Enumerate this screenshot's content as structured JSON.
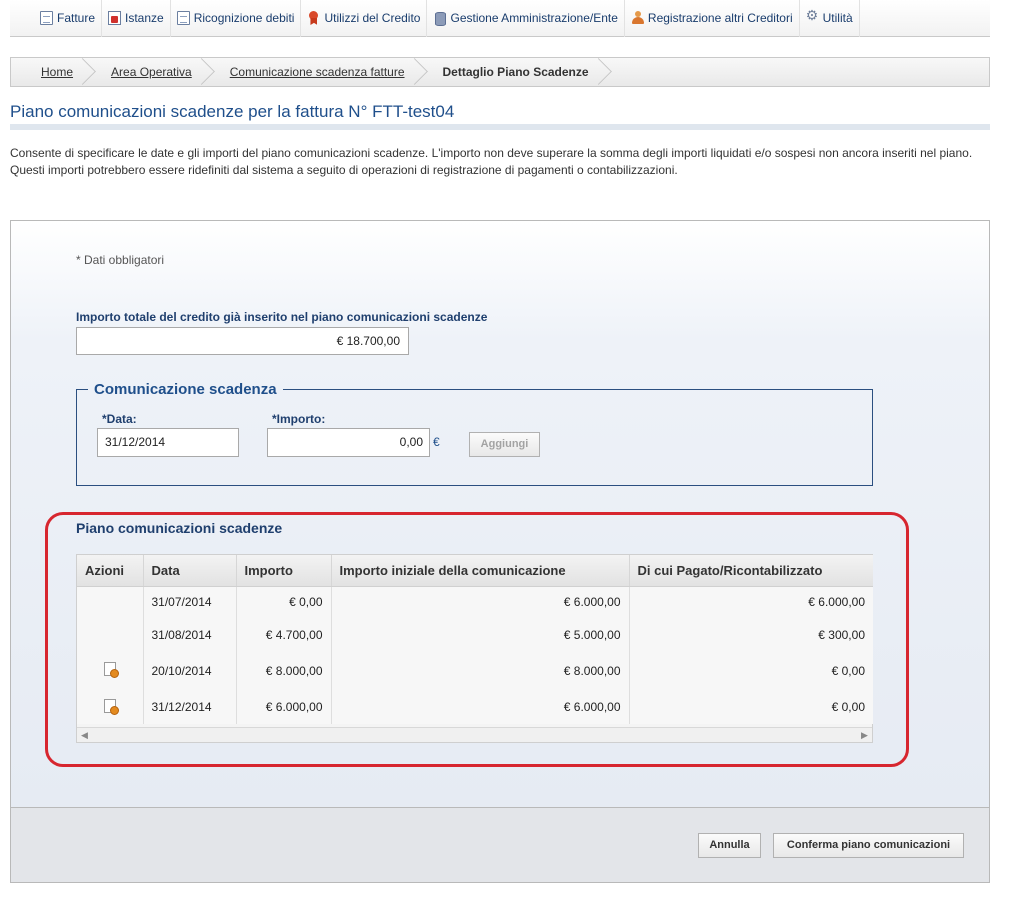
{
  "nav": {
    "items": [
      {
        "label": "Fatture",
        "icon": "document-icon"
      },
      {
        "label": "Istanze",
        "icon": "red-document-icon"
      },
      {
        "label": "Ricognizione debiti",
        "icon": "document-icon"
      },
      {
        "label": "Utilizzi del Credito",
        "icon": "ribbon-icon"
      },
      {
        "label": "Gestione Amministrazione/Ente",
        "icon": "database-icon"
      },
      {
        "label": "Registrazione altri Creditori",
        "icon": "person-icon"
      },
      {
        "label": "Utilità",
        "icon": "gear-icon"
      }
    ]
  },
  "breadcrumb": [
    "Home",
    "Area Operativa",
    "Comunicazione scadenza fatture",
    "Dettaglio Piano Scadenze"
  ],
  "page": {
    "title": "Piano comunicazioni scadenze per la fattura N° FTT-test04",
    "intro": "Consente di specificare le date e gli importi del piano comunicazioni scadenze. L'importo non deve superare la somma degli importi liquidati e/o sospesi non ancora inseriti nel piano. Questi importi potrebbero essere ridefiniti dal sistema a seguito di operazioni di registrazione di pagamenti o contabilizzazioni."
  },
  "form": {
    "required_note": "* Dati obbligatori",
    "total_label": "Importo totale del credito già inserito nel piano comunicazioni scadenze",
    "total_value": "€ 18.700,00",
    "fieldset_legend": "Comunicazione scadenza",
    "data_label": "*Data:",
    "data_value": "31/12/2014",
    "importo_label": "*Importo:",
    "importo_value": "0,00",
    "currency": "€",
    "add_button": "Aggiungi"
  },
  "plan": {
    "title": "Piano comunicazioni scadenze",
    "headers": [
      "Azioni",
      "Data",
      "Importo",
      "Importo iniziale della comunicazione",
      "Di cui Pagato/Ricontabilizzato"
    ],
    "rows": [
      {
        "action": false,
        "data": "31/07/2014",
        "importo": "€  0,00",
        "iniziale": "€  6.000,00",
        "pagato": "€  6.000,00"
      },
      {
        "action": false,
        "data": "31/08/2014",
        "importo": "€  4.700,00",
        "iniziale": "€  5.000,00",
        "pagato": "€  300,00"
      },
      {
        "action": true,
        "data": "20/10/2014",
        "importo": "€  8.000,00",
        "iniziale": "€  8.000,00",
        "pagato": "€  0,00"
      },
      {
        "action": true,
        "data": "31/12/2014",
        "importo": "€  6.000,00",
        "iniziale": "€  6.000,00",
        "pagato": "€  0,00"
      }
    ]
  },
  "footer": {
    "cancel_button": "Annulla",
    "confirm_button": "Conferma piano comunicazioni"
  },
  "colors": {
    "highlight": "#d7262f",
    "title_blue": "#1f4f8b"
  }
}
